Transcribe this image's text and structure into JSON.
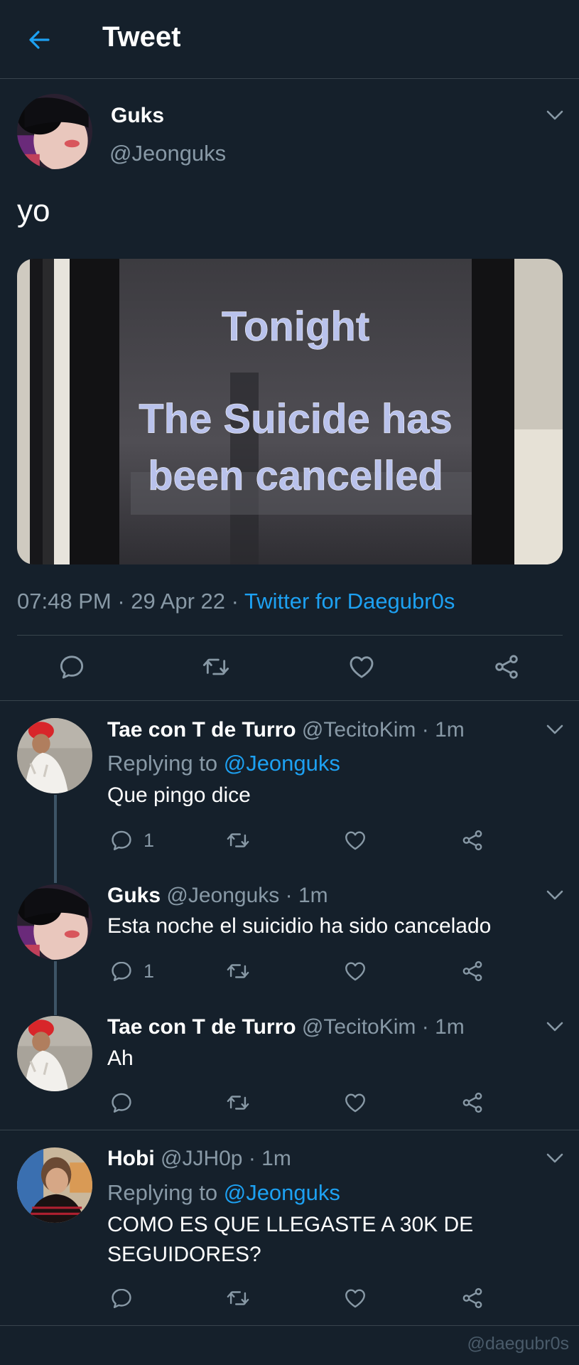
{
  "header": {
    "title": "Tweet",
    "back_icon": "arrow-left-icon"
  },
  "main_tweet": {
    "name": "Guks",
    "handle": "@Jeonguks",
    "text": "yo",
    "media_text": [
      "Tonight",
      "The Suicide has",
      "been cancelled"
    ],
    "time": "07:48 PM",
    "date": "29 Apr 22",
    "source": "Twitter for Daegubr0s",
    "actions": [
      "reply-icon",
      "retweet-icon",
      "like-icon",
      "share-icon"
    ]
  },
  "replies": [
    {
      "name": "Tae con T de Turro",
      "handle": "@TecitoKim",
      "time": "1m",
      "replying_prefix": "Replying to",
      "replying_to": "@Jeonguks",
      "text": "Que pingo dice",
      "reply_count": "1"
    },
    {
      "name": "Guks",
      "handle": "@Jeonguks",
      "time": "1m",
      "text": "Esta noche el suicidio ha sido cancelado",
      "reply_count": "1"
    },
    {
      "name": "Tae con T de Turro",
      "handle": "@TecitoKim",
      "time": "1m",
      "text": "Ah",
      "reply_count": ""
    },
    {
      "name": "Hobi",
      "handle": "@JJH0p",
      "time": "1m",
      "replying_prefix": "Replying to",
      "replying_to": "@Jeonguks",
      "text_line1": "COMO ES QUE LLEGASTE A 30K DE",
      "text_line2": "SEGUIDORES?",
      "reply_count": ""
    }
  ],
  "watermark": "@daegubr0s",
  "colors": {
    "background": "#15202b",
    "accent": "#1da1f2",
    "secondary_text": "#8899a6",
    "divider": "#38444d"
  }
}
